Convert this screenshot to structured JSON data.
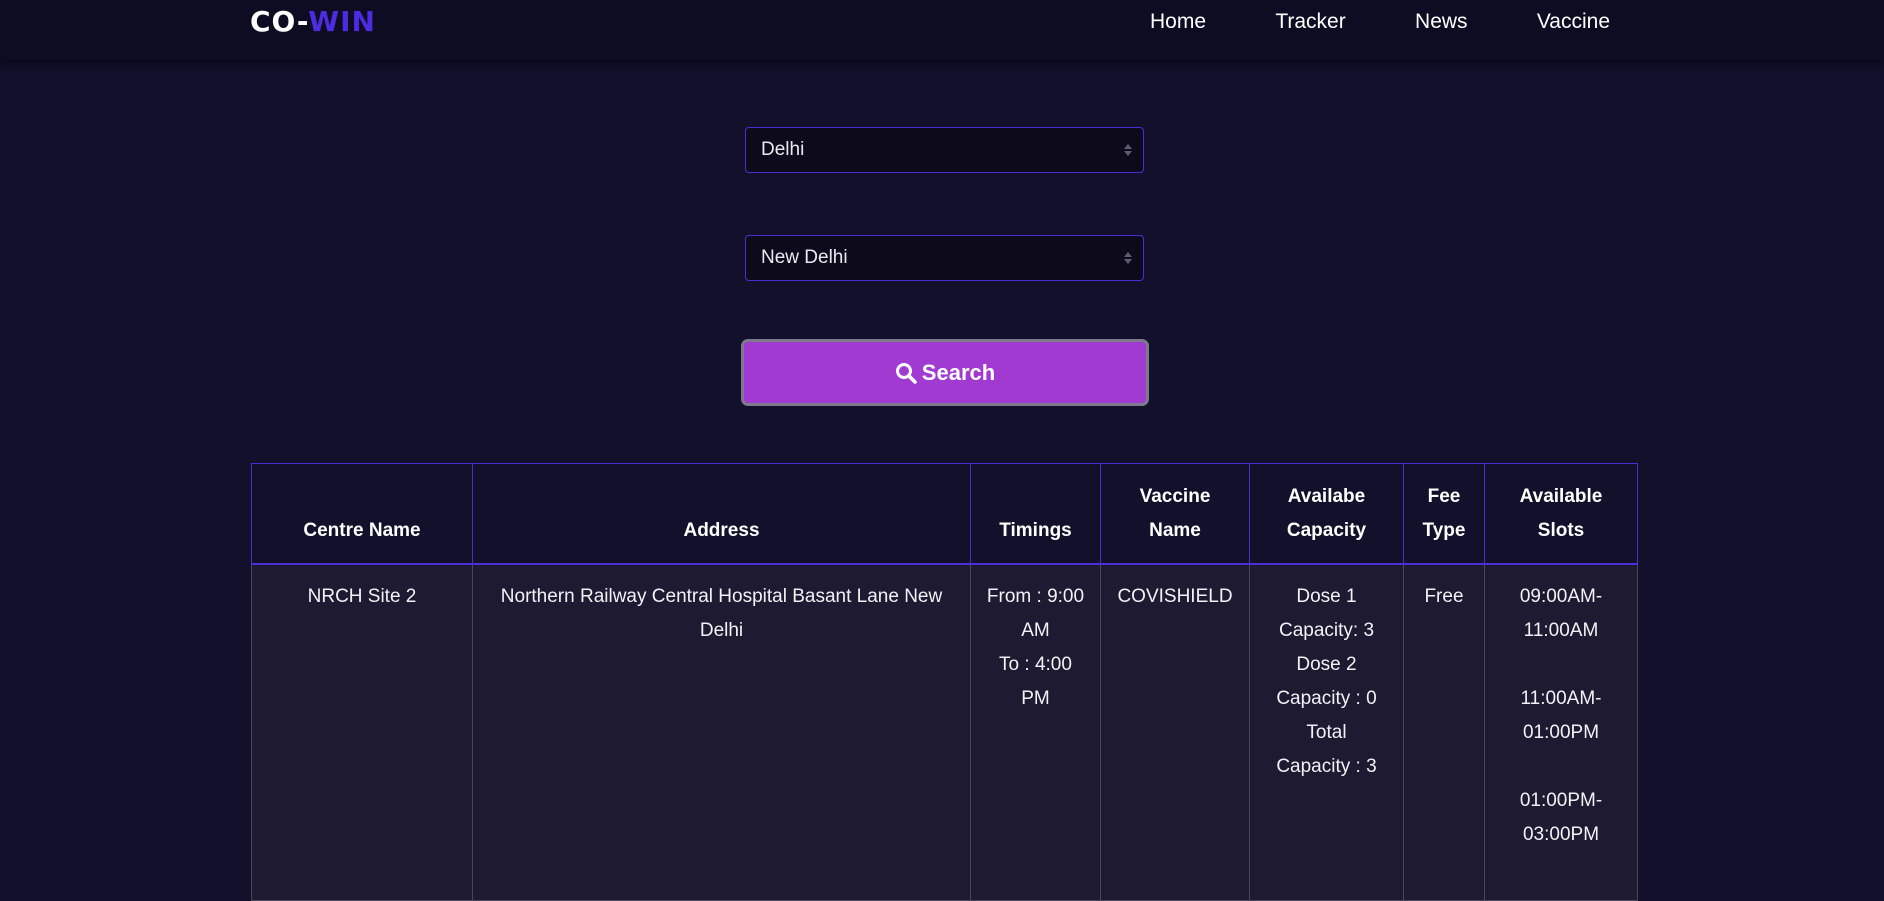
{
  "brand": {
    "part1": "CO-",
    "part2": "WIN",
    "accent_color": "#4c2be0"
  },
  "nav": {
    "items": [
      {
        "label": "Home"
      },
      {
        "label": "Tracker"
      },
      {
        "label": "News"
      },
      {
        "label": "Vaccine"
      }
    ]
  },
  "form": {
    "state": {
      "value": "Delhi"
    },
    "district": {
      "value": "New Delhi"
    },
    "search_label": "Search",
    "search_icon": "search-icon",
    "button_color": "#a03ad0"
  },
  "table": {
    "headers": {
      "centre_name": "Centre Name",
      "address": "Address",
      "timings_line1": "Timings",
      "vaccine_line1": "Vaccine",
      "vaccine_line2": "Name",
      "capacity_line1": "Availabe",
      "capacity_line2": "Capacity",
      "fee_line1": "Fee",
      "fee_line2": "Type",
      "slots_line1": "Available",
      "slots_line2": "Slots"
    },
    "rows": [
      {
        "centre_name": "NRCH Site 2",
        "address": "Northern Railway Central Hospital Basant Lane New Delhi",
        "timings": {
          "from": "From : 9:00 AM",
          "to": "To : 4:00 PM"
        },
        "vaccine": "COVISHIELD",
        "capacity": {
          "dose1_title": "Dose 1",
          "dose1": "Capacity: 3",
          "dose2_title": "Dose 2",
          "dose2": "Capacity : 0",
          "total_title": "Total",
          "total": "Capacity : 3"
        },
        "fee": "Free",
        "slots": [
          "09:00AM-11:00AM",
          "11:00AM-01:00PM",
          "01:00PM-03:00PM"
        ]
      }
    ]
  },
  "colors": {
    "background": "#12102a",
    "navbar": "#0e0c22",
    "border_accent": "#4b2fd6",
    "row_background": "#1d1a31"
  }
}
